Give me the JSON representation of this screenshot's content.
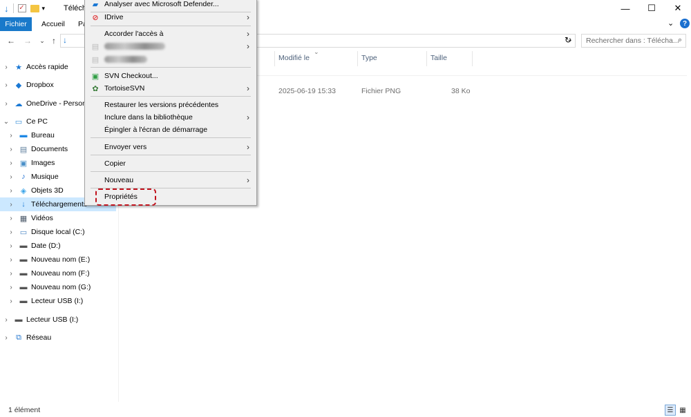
{
  "window": {
    "title": "Télécha",
    "controls": {
      "minimize": "—",
      "maximize": "☐",
      "close": "✕"
    }
  },
  "ribbon": {
    "tabs": [
      "Fichier",
      "Accueil",
      "Pa"
    ],
    "help_label": "?"
  },
  "nav": {
    "back_icon": "←",
    "forward_icon": "→",
    "recent_icon": "⌄",
    "up_icon": "↑",
    "search_placeholder": "Rechercher dans : Télécha..."
  },
  "sidebar": {
    "items": [
      {
        "label": "Accès rapide",
        "icon": "star-icon",
        "glyph": "★",
        "color": "#1a78d4"
      },
      {
        "label": "Dropbox",
        "icon": "dropbox-icon",
        "glyph": "◆",
        "color": "#1a78d4"
      },
      {
        "label": "OneDrive - Persona",
        "icon": "cloud-icon",
        "glyph": "☁",
        "color": "#1a78d4"
      },
      {
        "label": "Ce PC",
        "icon": "computer-icon",
        "glyph": "▭",
        "color": "#3a8fd9"
      },
      {
        "label": "Bureau",
        "icon": "desktop-icon",
        "glyph": "▬",
        "color": "#1e88e5"
      },
      {
        "label": "Documents",
        "icon": "documents-icon",
        "glyph": "▤",
        "color": "#5f7f9e"
      },
      {
        "label": "Images",
        "icon": "pictures-icon",
        "glyph": "▣",
        "color": "#4a90c8"
      },
      {
        "label": "Musique",
        "icon": "music-icon",
        "glyph": "♪",
        "color": "#1f6fd1"
      },
      {
        "label": "Objets 3D",
        "icon": "3d-objects-icon",
        "glyph": "◈",
        "color": "#3aa4e8"
      },
      {
        "label": "Téléchargements",
        "icon": "downloads-icon",
        "glyph": "↓",
        "color": "#1a78d4"
      },
      {
        "label": "Vidéos",
        "icon": "videos-icon",
        "glyph": "▦",
        "color": "#4c5a6a"
      },
      {
        "label": "Disque local (C:)",
        "icon": "drive-c-icon",
        "glyph": "▭",
        "color": "#4b86c5"
      },
      {
        "label": "Date (D:)",
        "icon": "drive-icon",
        "glyph": "▬",
        "color": "#555555"
      },
      {
        "label": "Nouveau nom (E:)",
        "icon": "drive-icon",
        "glyph": "▬",
        "color": "#555555"
      },
      {
        "label": "Nouveau nom (F:)",
        "icon": "drive-icon",
        "glyph": "▬",
        "color": "#555555"
      },
      {
        "label": "Nouveau nom (G:)",
        "icon": "drive-icon",
        "glyph": "▬",
        "color": "#555555"
      },
      {
        "label": "Lecteur USB (I:)",
        "icon": "usb-drive-icon",
        "glyph": "▬",
        "color": "#555555"
      },
      {
        "label": "Lecteur USB (I:)",
        "icon": "usb-drive-icon",
        "glyph": "▬",
        "color": "#555555"
      },
      {
        "label": "Réseau",
        "icon": "network-icon",
        "glyph": "⧉",
        "color": "#2a7bd0"
      }
    ]
  },
  "columns": {
    "modified": "Modifié le",
    "type": "Type",
    "size": "Taille"
  },
  "file_row": {
    "modified": "2025-06-19 15:33",
    "type": "Fichier PNG",
    "size": "38 Ko"
  },
  "context_menu": {
    "items": {
      "defender": "Analyser avec Microsoft Defender...",
      "idrive": "IDrive",
      "access": "Accorder l'accès à",
      "svn_checkout": "SVN Checkout...",
      "tortoise": "TortoiseSVN",
      "restore": "Restaurer les versions précédentes",
      "library": "Inclure dans la bibliothèque",
      "pin": "Épingler à l'écran de démarrage",
      "send_to": "Envoyer vers",
      "copy": "Copier",
      "new": "Nouveau",
      "properties": "Propriétés"
    },
    "highlight_color": "#c0101a"
  },
  "status": {
    "count": "1 élément"
  }
}
